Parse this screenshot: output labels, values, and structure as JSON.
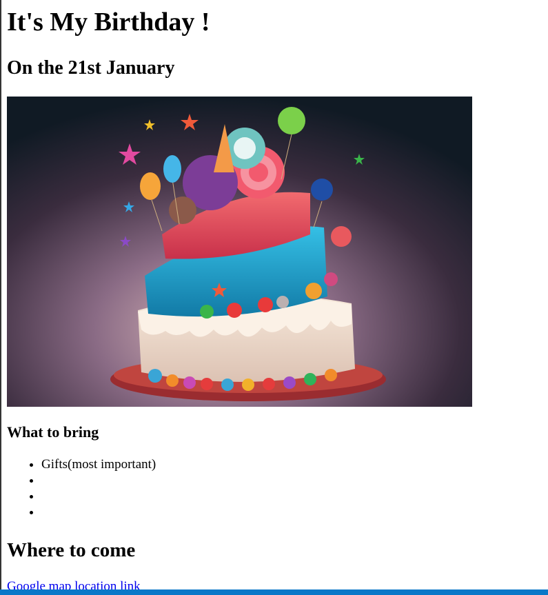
{
  "page": {
    "title": "It's My Birthday !",
    "date_heading": "On the 21st January"
  },
  "image": {
    "alt": "Birthday cake",
    "colors": {
      "background": "#2b1e2e",
      "bg_glow": "#b28fa0",
      "cake_cream": "#f2e0d0",
      "cake_blue": "#1f9fc9",
      "cake_red": "#e7465a",
      "plate": "#b5383b"
    }
  },
  "bring": {
    "heading": "What to bring",
    "items": [
      "Gifts(most important)",
      "",
      "",
      ""
    ]
  },
  "where": {
    "heading": "Where to come",
    "link_text": "Google map location link"
  },
  "status_bar": {
    "color": "#0a78c8"
  }
}
